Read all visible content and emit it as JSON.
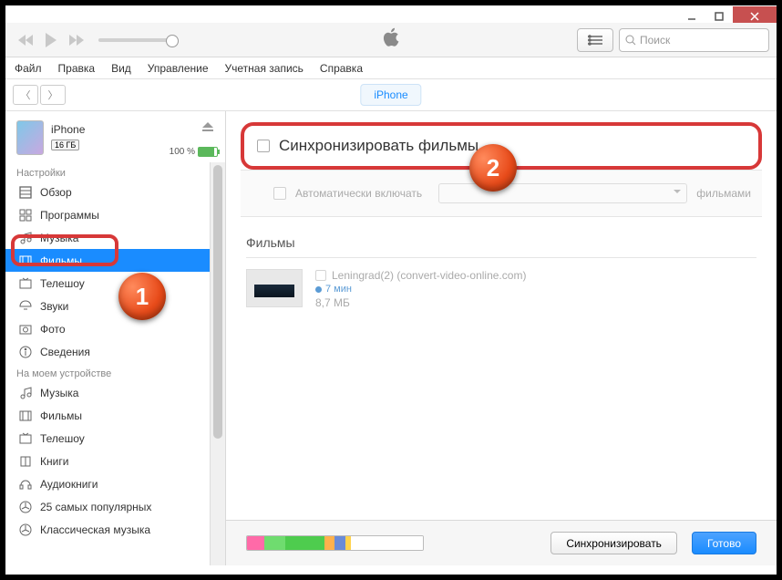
{
  "titlebar": {},
  "toolbar": {
    "search_placeholder": "Поиск"
  },
  "menu": {
    "file": "Файл",
    "edit": "Правка",
    "view": "Вид",
    "controls": "Управление",
    "account": "Учетная запись",
    "help": "Справка"
  },
  "header": {
    "device_pill": "iPhone"
  },
  "device": {
    "name": "iPhone",
    "capacity": "16 ГБ",
    "battery_pct": "100 %"
  },
  "sidebar": {
    "section_settings": "Настройки",
    "section_on_device": "На моем устройстве",
    "settings": [
      "Обзор",
      "Программы",
      "Музыка",
      "Фильмы",
      "Телешоу",
      "Звуки",
      "Фото",
      "Сведения"
    ],
    "on_device": [
      "Музыка",
      "Фильмы",
      "Телешоу",
      "Книги",
      "Аудиокниги",
      "25 самых популярных",
      "Классическая музыка"
    ]
  },
  "content": {
    "sync_movies_label": "Синхронизировать фильмы",
    "auto_include_label": "Автоматически включать",
    "movies_suffix": "фильмами",
    "films_header": "Фильмы",
    "film": {
      "title": "Leningrad(2) (convert-video-online.com)",
      "duration": "7 мин",
      "size": "8,7 МБ"
    }
  },
  "footer": {
    "sync_btn": "Синхронизировать",
    "done_btn": "Готово"
  },
  "callouts": {
    "one": "1",
    "two": "2"
  }
}
